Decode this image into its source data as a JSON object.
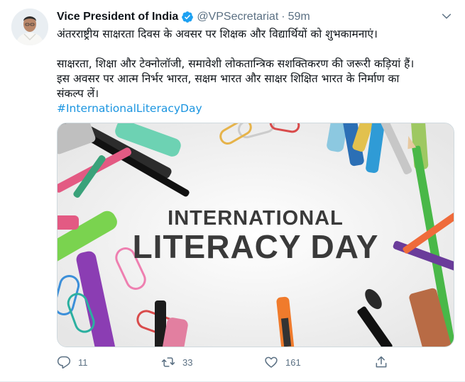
{
  "author": {
    "name": "Vice President of India",
    "handle": "@VPSecretariat",
    "separator": "·",
    "time": "59m"
  },
  "tweet": {
    "line1": "अंतरराष्ट्रीय साक्षरता दिवस के अवसर पर शिक्षक और विद्यार्थियों को शुभकामनाएं।",
    "line2": "साक्षरता, शिक्षा और टेक्नोलॉजी, समावेशी लोकतान्त्रिक सशक्तिकरण की जरूरी कड़ियां हैं।",
    "line3": "इस अवसर पर आत्म निर्भर भारत, सक्षम भारत और साक्षर शिक्षित भारत के निर्माण का",
    "line4": "संकल्प लें।",
    "hashtag": "#InternationalLiteracyDay"
  },
  "image": {
    "line1": "INTERNATIONAL",
    "line2": "LITERACY DAY"
  },
  "actions": {
    "reply_count": "11",
    "retweet_count": "33",
    "like_count": "161"
  },
  "colors": {
    "verified": "#1da1f2",
    "hashtag": "#1b95e0",
    "muted": "#5b7083"
  },
  "icons": [
    "verified-badge-icon",
    "chevron-down-icon",
    "reply-icon",
    "retweet-icon",
    "like-icon",
    "share-icon"
  ]
}
